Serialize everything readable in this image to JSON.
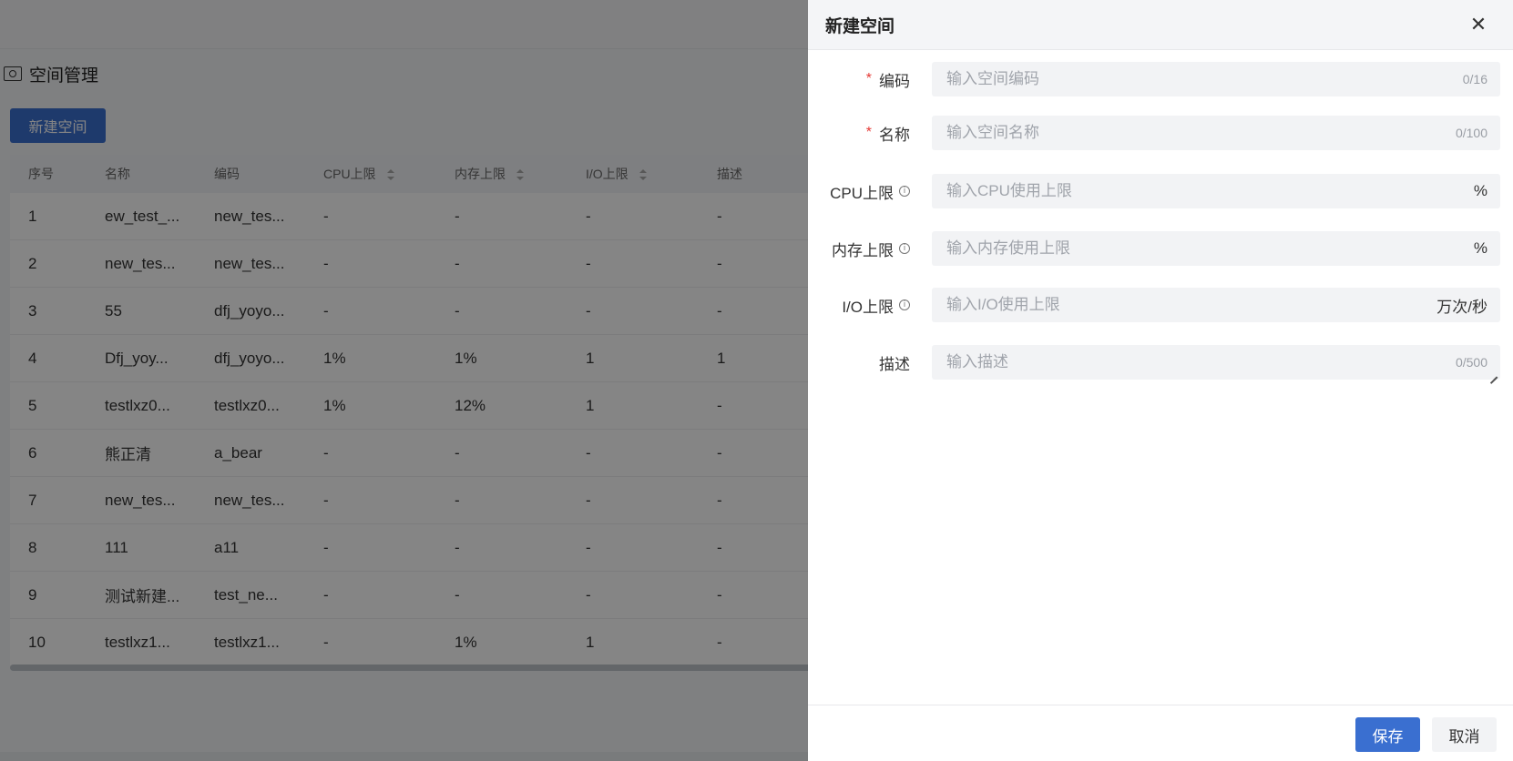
{
  "page": {
    "section_title": "空间管理",
    "new_button": "新建空间",
    "table": {
      "headers": [
        "序号",
        "名称",
        "编码",
        "CPU上限",
        "内存上限",
        "I/O上限",
        "描述"
      ],
      "rows": [
        [
          "1",
          "ew_test_...",
          "new_tes...",
          "-",
          "-",
          "-",
          "-"
        ],
        [
          "2",
          "new_tes...",
          "new_tes...",
          "-",
          "-",
          "-",
          "-"
        ],
        [
          "3",
          "55",
          "dfj_yoyo...",
          "-",
          "-",
          "-",
          "-"
        ],
        [
          "4",
          "Dfj_yoy...",
          "dfj_yoyo...",
          "1%",
          "1%",
          "1",
          "1"
        ],
        [
          "5",
          "testlxz0...",
          "testlxz0...",
          "1%",
          "12%",
          "1",
          "-"
        ],
        [
          "6",
          "熊正清",
          "a_bear",
          "-",
          "-",
          "-",
          "-"
        ],
        [
          "7",
          "new_tes...",
          "new_tes...",
          "-",
          "-",
          "-",
          "-"
        ],
        [
          "8",
          "111",
          "a11",
          "-",
          "-",
          "-",
          "-"
        ],
        [
          "9",
          "测试新建...",
          "test_ne...",
          "-",
          "-",
          "-",
          "-"
        ],
        [
          "10",
          "testlxz1...",
          "testlxz1...",
          "-",
          "1%",
          "1",
          "-"
        ]
      ]
    }
  },
  "drawer": {
    "title": "新建空间",
    "close_icon": "close-icon",
    "fields": {
      "code": {
        "label": "编码",
        "required_mark": "*",
        "placeholder": "输入空间编码",
        "value": "",
        "counter": "0/16"
      },
      "name": {
        "label": "名称",
        "required_mark": "*",
        "placeholder": "输入空间名称",
        "value": "",
        "counter": "0/100"
      },
      "cpu": {
        "label": "CPU上限",
        "info_icon": "info-icon",
        "placeholder": "输入CPU使用上限",
        "value": "",
        "unit": "%"
      },
      "memory": {
        "label": "内存上限",
        "info_icon": "info-icon",
        "placeholder": "输入内存使用上限",
        "value": "",
        "unit": "%"
      },
      "io": {
        "label": "I/O上限",
        "info_icon": "info-icon",
        "placeholder": "输入I/O使用上限",
        "value": "",
        "unit": "万次/秒"
      },
      "description": {
        "label": "描述",
        "placeholder": "输入描述",
        "value": "",
        "counter": "0/500"
      }
    },
    "footer": {
      "save_label": "保存",
      "cancel_label": "取消"
    },
    "colors": {
      "primary": "#3a6fd0",
      "required": "#e53935"
    }
  }
}
